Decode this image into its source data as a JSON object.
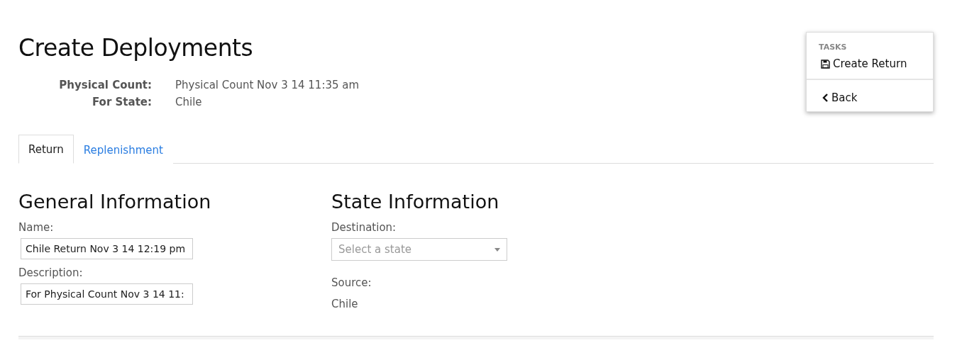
{
  "page": {
    "title": "Create Deployments"
  },
  "summary": [
    {
      "label": "Physical Count:",
      "value": "Physical Count Nov 3 14 11:35 am"
    },
    {
      "label": "For State:",
      "value": "Chile"
    }
  ],
  "tasks": {
    "heading": "TASKS",
    "items": [
      {
        "kind": "save",
        "label": "Create Return"
      },
      {
        "kind": "back",
        "label": "Back"
      }
    ]
  },
  "tabs": [
    {
      "label": "Return",
      "selected": true
    },
    {
      "label": "Replenishment",
      "selected": false
    }
  ],
  "general": {
    "heading": "General Information",
    "fields": [
      {
        "label": "Name:",
        "value": "Chile Return Nov 3 14 12:19 pm"
      },
      {
        "label": "Description:",
        "value": "For Physical Count Nov 3 14 11:"
      }
    ]
  },
  "state": {
    "heading": "State Information",
    "destination": {
      "label": "Destination:",
      "placeholder": "Select a state"
    },
    "source": {
      "label": "Source:",
      "value": "Chile"
    }
  }
}
